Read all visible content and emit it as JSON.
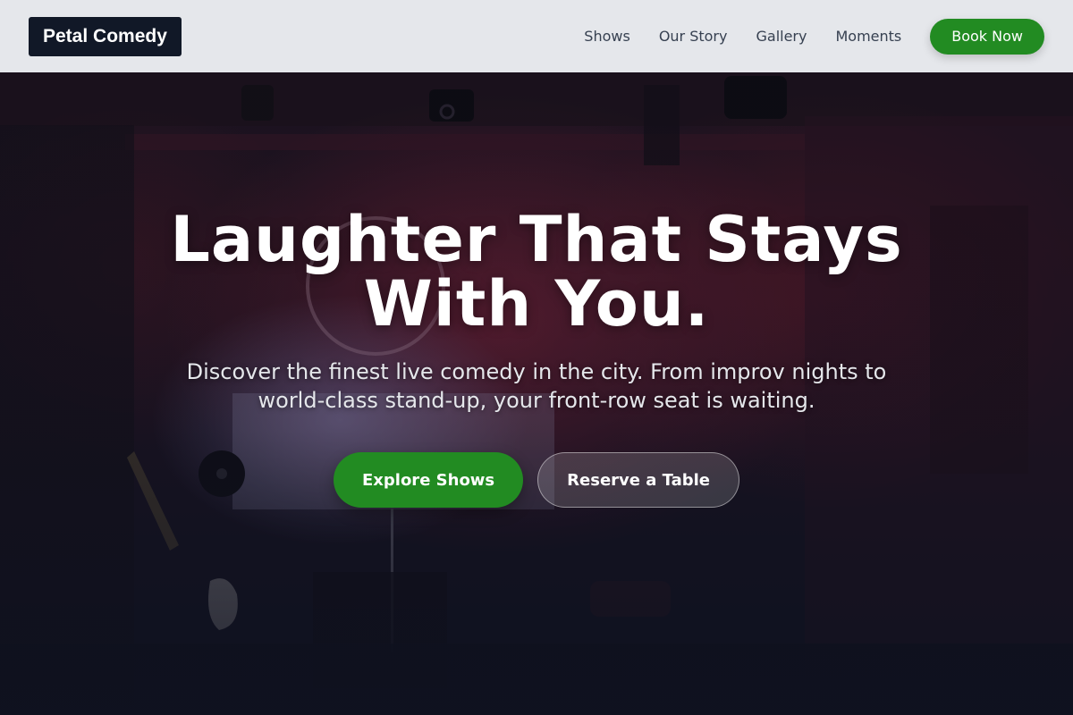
{
  "brand": {
    "name": "Petal Comedy"
  },
  "nav": {
    "links": [
      "Shows",
      "Our Story",
      "Gallery",
      "Moments"
    ],
    "cta": "Book Now"
  },
  "hero": {
    "title": "Laughter That Stays With You.",
    "subtitle": "Discover the finest live comedy in the city. From improv nights to world-class stand-up, your front-row seat is waiting.",
    "primary_cta": "Explore Shows",
    "secondary_cta": "Reserve a Table"
  },
  "colors": {
    "accent_green": "#228b22",
    "brand_dark": "#111827",
    "nav_bg": "#eceef2",
    "hero_dark": "#0f1220"
  }
}
